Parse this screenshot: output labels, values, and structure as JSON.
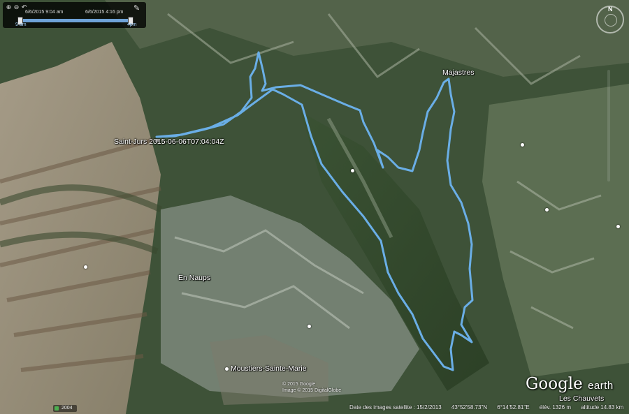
{
  "timebar": {
    "start_label": "6/6/2015  9:04 am",
    "end_label": "6/6/2015  4:16 pm",
    "left_tick": "9 am",
    "right_tick": "4pm"
  },
  "places": {
    "majastres": "Majastres",
    "en_naups": "En Naups",
    "moustiers": "Moustiers-Sainte-Marie",
    "les_chauvets": "Les Chauvets",
    "track_label": "Saint-Jurs 2015-06-06T07:04:04Z"
  },
  "copyright": {
    "line1": "© 2015 Google",
    "line2": "Image © 2015 DigitalGlobe"
  },
  "status_bar": {
    "imagery_date": "Date des images satellite : 15/2/2013",
    "lat": "43°52'58.73\"N",
    "lon": "6°14'52.81\"E",
    "elev": "élév. 1326 m",
    "altitude": "altitude  14.83 km"
  },
  "tour_chip": "2004",
  "logo": {
    "google": "Google",
    "earth": "earth"
  },
  "colors": {
    "track": "#6aaee6",
    "plateau": "#c8b4a2",
    "forest": "#2f4528",
    "rock": "#8a948a"
  },
  "icons": {
    "zoom_in": "zoom-in-icon",
    "zoom_out": "zoom-out-icon",
    "rewind": "rewind-icon",
    "tools": "wrench-icon",
    "compass": "compass-icon"
  }
}
